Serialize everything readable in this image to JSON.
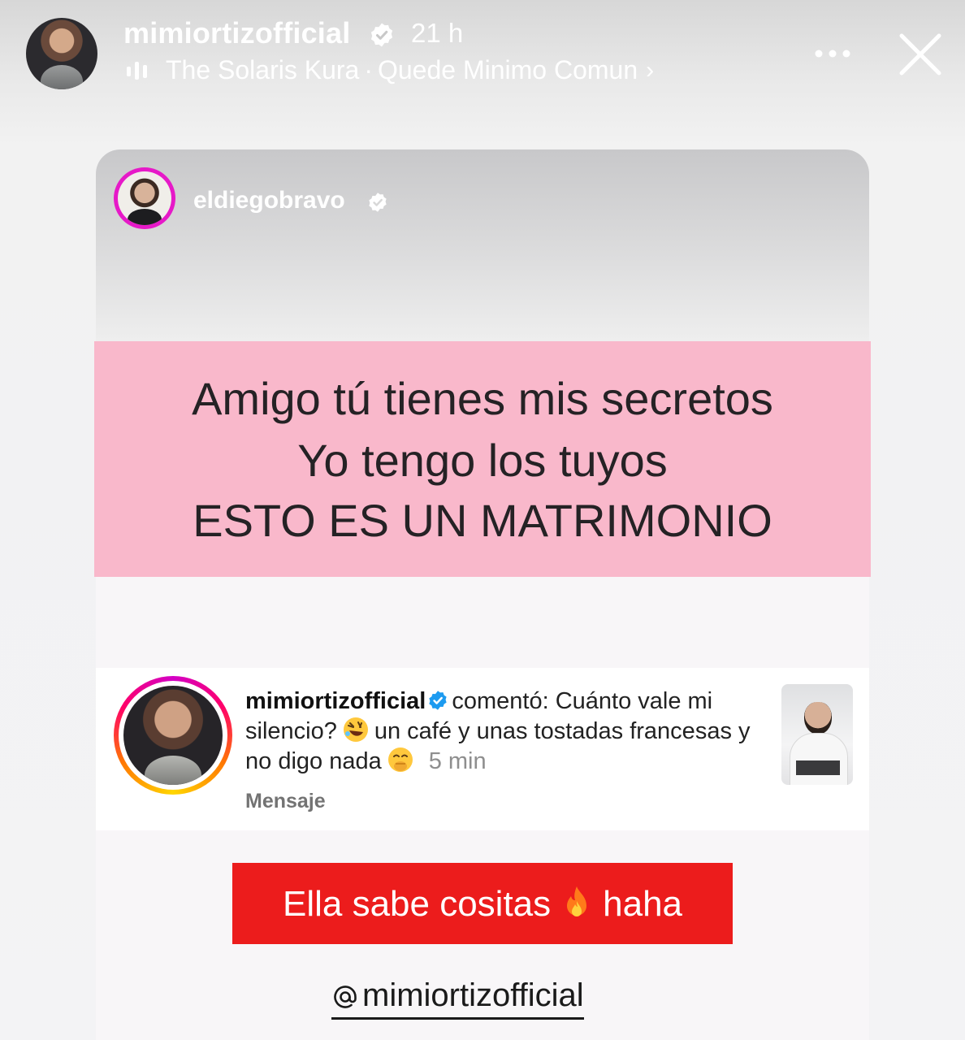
{
  "story": {
    "username": "mimiortizofficial",
    "time": "21 h",
    "music": {
      "artist": "The Solaris Kura",
      "separator": "·",
      "track": "Quede Minimo Comun",
      "chevron": "›"
    }
  },
  "card": {
    "username": "eldiegobravo",
    "pink_lines": [
      "Amigo tú tienes mis secretos",
      "Yo tengo los tuyos",
      "ESTO ES UN MATRIMONIO"
    ],
    "comment": {
      "username": "mimiortizofficial",
      "text_part1": "comentó: Cuánto vale mi silencio?",
      "text_part2": "un café y unas tostadas francesas y no digo nada",
      "time": "5 min",
      "action": "Mensaje",
      "emoji1": "rolling-on-floor-laughing-emoji",
      "emoji2": "hand-over-mouth-emoji"
    }
  },
  "red_banner": {
    "part1": "Ella sabe cositas",
    "part2": "haha",
    "emoji": "fire-emoji",
    "color": "#ec1c1c"
  },
  "mention": {
    "handle": "mimiortizofficial"
  },
  "colors": {
    "pink_banner": "#f9b8cb",
    "verified_blue": "#1d9bf0",
    "avatar_ring_magenta": "#e619c8"
  }
}
